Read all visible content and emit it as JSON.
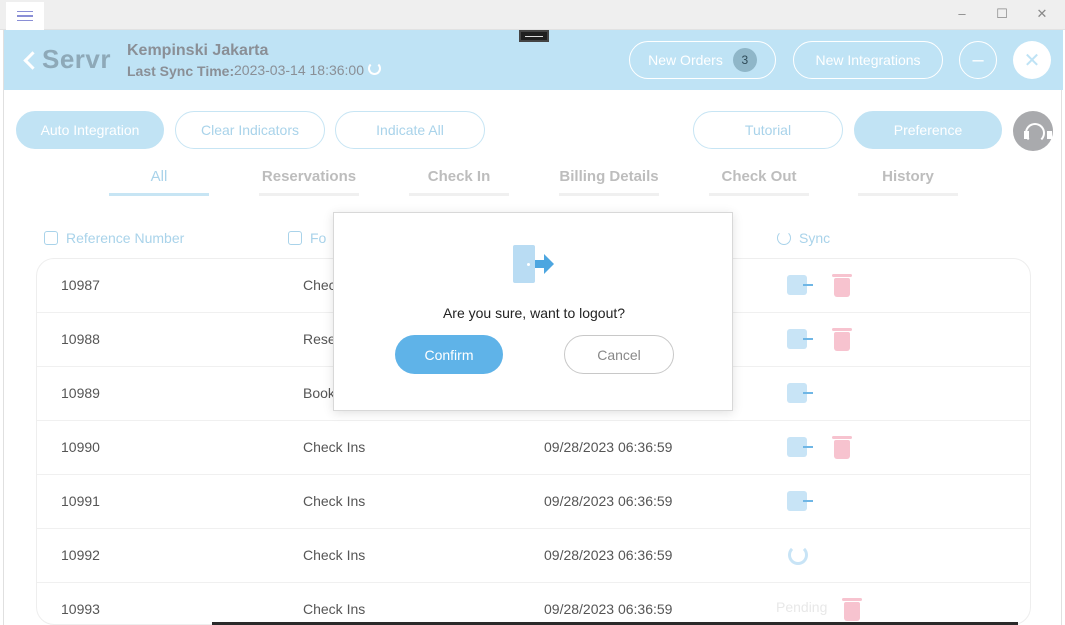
{
  "window": {
    "minimize_glyph": "–",
    "maximize_glyph": "☐",
    "close_glyph": "✕"
  },
  "header": {
    "brand": "Servr",
    "hotel_name": "Kempinski Jakarta",
    "last_sync_label": "Last Sync Time:",
    "last_sync_value": "2023-03-14 18:36:00",
    "new_orders_label": "New Orders",
    "new_orders_count": "3",
    "new_integrations_label": "New Integrations",
    "minimize_glyph": "–",
    "close_glyph": "✕"
  },
  "actions": {
    "auto_integration": "Auto Integration",
    "clear_indicators": "Clear Indicators",
    "indicate_all": "Indicate All",
    "tutorial": "Tutorial",
    "preference": "Preference"
  },
  "tabs": [
    {
      "label": "All",
      "active": true
    },
    {
      "label": "Reservations",
      "active": false
    },
    {
      "label": "Check  In",
      "active": false
    },
    {
      "label": "Billing  Details",
      "active": false
    },
    {
      "label": "Check  Out",
      "active": false
    },
    {
      "label": "History",
      "active": false
    }
  ],
  "table": {
    "columns": {
      "reference": "Reference Number",
      "form": "Fo",
      "sync": "Sync"
    },
    "rows": [
      {
        "ref": "10987",
        "form": "Check",
        "date": "",
        "sync": "door",
        "trash": true
      },
      {
        "ref": "10988",
        "form": "Reser",
        "date": "",
        "sync": "door",
        "trash": true
      },
      {
        "ref": "10989",
        "form": "Book",
        "date": "",
        "sync": "door",
        "trash": false
      },
      {
        "ref": "10990",
        "form": "Check Ins",
        "date": "09/28/2023 06:36:59",
        "sync": "door-out",
        "trash": true
      },
      {
        "ref": "10991",
        "form": "Check Ins",
        "date": "09/28/2023 06:36:59",
        "sync": "door-out",
        "trash": false
      },
      {
        "ref": "10992",
        "form": "Check Ins",
        "date": "09/28/2023 06:36:59",
        "sync": "refresh",
        "trash": false
      },
      {
        "ref": "10993",
        "form": "Check Ins",
        "date": "09/28/2023 06:36:59",
        "sync": "pending",
        "trash": true,
        "pending_label": "Pending"
      }
    ]
  },
  "modal": {
    "message": "Are you sure, want to logout?",
    "confirm_label": "Confirm",
    "cancel_label": "Cancel",
    "icon": "logout-icon"
  },
  "colors": {
    "header_bg": "#bfe3f5",
    "accent": "#5fb3e8",
    "delete": "#f7c3cf"
  }
}
